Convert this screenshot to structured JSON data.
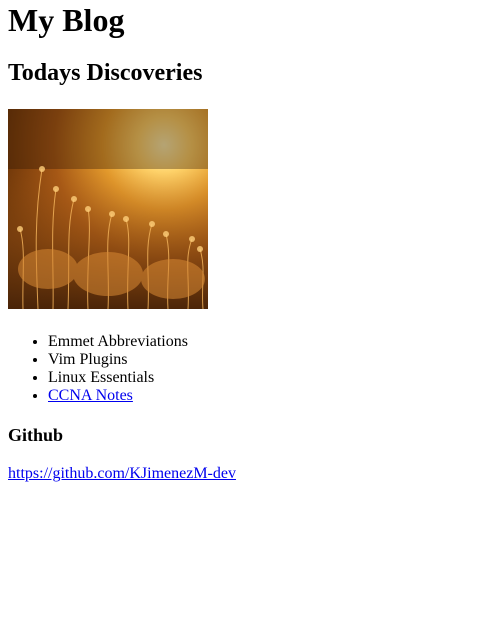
{
  "header": {
    "title": "My Blog"
  },
  "section": {
    "heading": "Todays Discoveries",
    "image_alt": "golden-grass-field-at-sunset",
    "list": [
      {
        "label": "Emmet Abbreviations",
        "is_link": false
      },
      {
        "label": "Vim Plugins",
        "is_link": false
      },
      {
        "label": "Linux Essentials",
        "is_link": false
      },
      {
        "label": "CCNA Notes",
        "is_link": true
      }
    ]
  },
  "github": {
    "heading": "Github",
    "link": "https://github.com/KJimenezM-dev"
  },
  "colors": {
    "link": "#0000ee",
    "text": "#000000",
    "background": "#ffffff"
  }
}
